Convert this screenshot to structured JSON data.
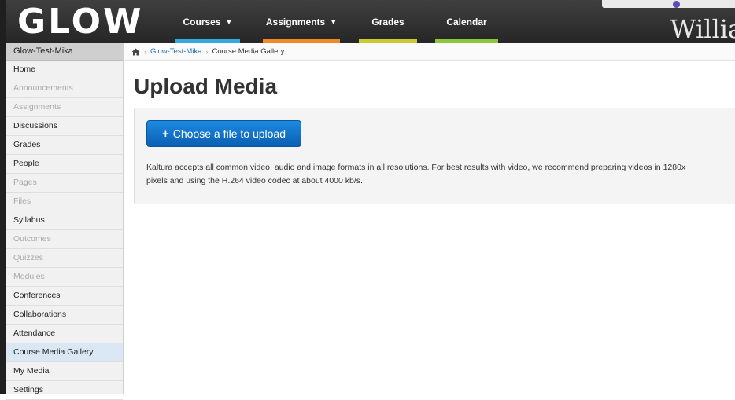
{
  "header": {
    "logo": "GLOW",
    "nav": [
      {
        "label": "Courses",
        "has_caret": true,
        "bar_color": "#35a8e0"
      },
      {
        "label": "Assignments",
        "has_caret": true,
        "bar_color": "#f08a24"
      },
      {
        "label": "Grades",
        "has_caret": false,
        "bar_color": "#c9c930"
      },
      {
        "label": "Calendar",
        "has_caret": false,
        "bar_color": "#8cc63f"
      }
    ],
    "right_text": "Willia"
  },
  "sidebar": {
    "title": "Glow-Test-Mika",
    "items": [
      {
        "label": "Home",
        "state": "enabled"
      },
      {
        "label": "Announcements",
        "state": "disabled"
      },
      {
        "label": "Assignments",
        "state": "disabled"
      },
      {
        "label": "Discussions",
        "state": "enabled"
      },
      {
        "label": "Grades",
        "state": "enabled"
      },
      {
        "label": "People",
        "state": "enabled"
      },
      {
        "label": "Pages",
        "state": "disabled"
      },
      {
        "label": "Files",
        "state": "disabled"
      },
      {
        "label": "Syllabus",
        "state": "enabled"
      },
      {
        "label": "Outcomes",
        "state": "disabled"
      },
      {
        "label": "Quizzes",
        "state": "disabled"
      },
      {
        "label": "Modules",
        "state": "disabled"
      },
      {
        "label": "Conferences",
        "state": "enabled"
      },
      {
        "label": "Collaborations",
        "state": "enabled"
      },
      {
        "label": "Attendance",
        "state": "enabled"
      },
      {
        "label": "Course Media Gallery",
        "state": "active"
      },
      {
        "label": "My Media",
        "state": "enabled"
      },
      {
        "label": "Settings",
        "state": "enabled"
      }
    ]
  },
  "breadcrumb": {
    "home_icon": "home-icon",
    "course": "Glow-Test-Mika",
    "current": "Course Media Gallery"
  },
  "main": {
    "title": "Upload Media",
    "upload_button": "Choose a file to upload",
    "description": "Kaltura accepts all common video, audio and image formats in all resolutions. For best results with video, we recommend preparing videos in 1280x\npixels and using the H.264 video codec at about 4000 kb/s."
  },
  "colors": {
    "header_bg": "#2e2e2e",
    "link": "#1a6fb5",
    "button": "#0f6fc6",
    "active_item": "#d9e8f4"
  }
}
